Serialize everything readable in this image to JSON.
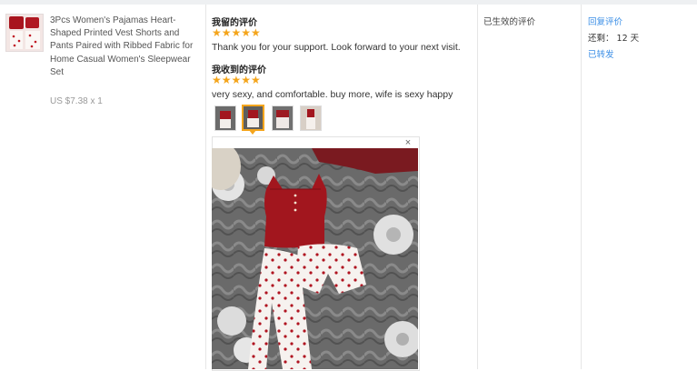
{
  "product": {
    "title": "3Pcs Women's Pajamas Heart-Shaped Printed Vest Shorts and Pants Paired with Ribbed Fabric for Home Casual Women's Sleepwear Set",
    "price": "US $7.38 x 1"
  },
  "my_review": {
    "label": "我留的评价",
    "rating": 5,
    "stars": "★★★★★",
    "text": "Thank you for your support. Look forward to your next visit."
  },
  "received_review": {
    "label": "我收到的评价",
    "rating": 5,
    "stars": "★★★★★",
    "text": "very sexy, and comfortable. buy more, wife is sexy happy",
    "photos_count": 4,
    "selected_photo": 2
  },
  "status": {
    "label": "已生效的评价"
  },
  "actions": {
    "reply": "回复评价",
    "remaining": "还剩：  12 天",
    "forwarded": "已转发"
  },
  "viewer": {
    "close": "×"
  },
  "colors": {
    "star": "#f4a51c",
    "link": "#3a8ee6",
    "top_red": "#a2161e"
  }
}
